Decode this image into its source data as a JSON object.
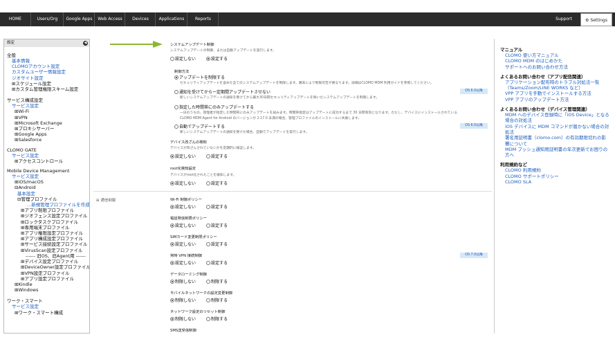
{
  "nav": {
    "tabs": [
      "HOME",
      "Users/Org",
      "Google Apps",
      "Web Access",
      "Devices",
      "Applications",
      "Reports"
    ],
    "support": "Support",
    "settings": "Settings"
  },
  "left": {
    "header": "設定",
    "groups": [
      {
        "title": "全般",
        "items": [
          {
            "t": "基本情報",
            "c": "link",
            "l": 1
          },
          {
            "t": "CLOMOアカウント設定",
            "c": "link",
            "l": 1
          },
          {
            "t": "カスタムユーザー情報設定",
            "c": "link",
            "l": 1
          },
          {
            "t": "ジオサイト設定",
            "c": "link",
            "l": 1
          },
          {
            "t": "⊞スケジュール設定",
            "c": "text",
            "l": 1
          },
          {
            "t": "⊞カスタム管理権限スキーム設定",
            "c": "text",
            "l": 1
          }
        ]
      },
      {
        "title": "サービス構成設定",
        "items": [
          {
            "t": "サービス設定",
            "c": "link",
            "l": 1
          },
          {
            "t": "⊞Wi-Fi",
            "c": "text",
            "l": 2
          },
          {
            "t": "⊞VPN",
            "c": "text",
            "l": 2
          },
          {
            "t": "⊞Microsoft Exchange",
            "c": "text",
            "l": 2
          },
          {
            "t": "⊞プロキシサーバー",
            "c": "text",
            "l": 2
          },
          {
            "t": "⊞Google Apps",
            "c": "text",
            "l": 2
          },
          {
            "t": "⊞Salesforce",
            "c": "text",
            "l": 2
          }
        ]
      },
      {
        "title": "CLOMO GATE",
        "items": [
          {
            "t": "サービス設定",
            "c": "link",
            "l": 1
          },
          {
            "t": "⊞アクセスコントロール",
            "c": "text",
            "l": 2
          }
        ]
      },
      {
        "title": "Mobile Device Management",
        "items": [
          {
            "t": "サービス設定",
            "c": "link",
            "l": 1
          },
          {
            "t": "⊞iOS/macOS",
            "c": "text",
            "l": 2
          },
          {
            "t": "⊟Android",
            "c": "text",
            "l": 2
          },
          {
            "t": "基本設定",
            "c": "link",
            "l": 3
          },
          {
            "t": "⊟管理プロファイル",
            "c": "text",
            "l": 3
          },
          {
            "t": "...新規管理プロファイルを作成",
            "c": "link",
            "l": 6
          },
          {
            "t": "⊞アプリ制限プロファイル",
            "c": "text",
            "l": 4
          },
          {
            "t": "⊞ジオフェンス設定プロファイル",
            "c": "text",
            "l": 4
          },
          {
            "t": "⊞ロックタスクプロファイル",
            "c": "text",
            "l": 4
          },
          {
            "t": "⊞専用端末プロファイル",
            "c": "text",
            "l": 4
          },
          {
            "t": "⊞アプリ権限設定プロファイル",
            "c": "text",
            "l": 4
          },
          {
            "t": "⊞アプリ構成設定プロファイル",
            "c": "text",
            "l": 4
          },
          {
            "t": "⊞サービス接続設定プロファイル",
            "c": "text",
            "l": 4
          },
          {
            "t": "⊞VirusScan設定プロファイル",
            "c": "text",
            "l": 4
          },
          {
            "t": "------ 旧OS、旧Agent用 ------",
            "c": "text",
            "l": 5
          },
          {
            "t": "⊞デバイス設定プロファイル",
            "c": "text",
            "l": 4
          },
          {
            "t": "⊞DeviceOwner設定プロファイル",
            "c": "text",
            "l": 4
          },
          {
            "t": "⊞VPN設定プロファイル",
            "c": "text",
            "l": 4
          },
          {
            "t": "⊞アプリ設定プロファイル",
            "c": "text",
            "l": 4
          },
          {
            "t": "⊞Kindle",
            "c": "text",
            "l": 2
          },
          {
            "t": "⊞Windows",
            "c": "text",
            "l": 2
          }
        ]
      },
      {
        "title": "ワーク・スマート",
        "items": [
          {
            "t": "サービス設定",
            "c": "link",
            "l": 1
          },
          {
            "t": "⊞ワーク・スマート構成",
            "c": "text",
            "l": 2
          }
        ]
      }
    ]
  },
  "main": {
    "sysupdate": {
      "title": "システムアップデート制御",
      "desc": "システムアップデートの制御、または自動アップデートを実行します。",
      "off": "設定しない",
      "on": "設定する"
    },
    "method": {
      "title": "制御方法",
      "opts": [
        {
          "label": "アップデートを制限する",
          "desc": [
            "セキュリティアップデートを含めた全てのシステムアップデートを制限します。端末により制限可否が異なります。詳細はCLOMO MDM 利用ガイドを参照してください。"
          ]
        },
        {
          "label": "通知を受けてから一定期間アップデートさせない",
          "badge": "OS 6.0以降",
          "desc": [
            "新しいシステムアップデートの通知を受けてから最大30日間セキュリティアップデートを除いたシステムアップデートを制限します。"
          ]
        },
        {
          "label": "指定した時間帯にのみアップデートする",
          "desc": [
            "一日のうちの、管理者が指定した時間帯にのみアップデートを試みます。時間帯指定はアップデートに成功するまで 30 日間有効となります。ただし、デバイスにインストールされている",
            "CLOMO MDM Agent for Android のバージョンが 2.17.0 未満の場合、管理プロファイルのインストールに失敗します。"
          ]
        },
        {
          "label": "自動でアップデートする",
          "badge": "OS 6.0以降",
          "desc": [
            "新しいシステムアップデートの通知を受けた場合、自動でアップデートを実行します。"
          ]
        }
      ]
    },
    "tamper": {
      "title": "デバイス改ざんの検知",
      "desc": "デバイスが改ざんされていないかを定期的に検証します。",
      "off": "設定しない",
      "on": "設定する"
    },
    "root": {
      "title": "root化検知設定",
      "desc": "デバイスがroot化されたことを検知します。",
      "off": "設定しない",
      "on": "設定する"
    },
    "section": "通信制御",
    "policies": [
      {
        "title": "Wi-Fi 制御ポリシー",
        "a": "設定しない",
        "b": "設定する"
      },
      {
        "title": "電話発信制限ポリシー",
        "a": "設定しない",
        "b": "設定する"
      },
      {
        "title": "SIMカード変更制限ポリシー",
        "a": "設定しない",
        "b": "設定する"
      },
      {
        "title": "常時 VPN 接続制御",
        "a": "設定しない",
        "b": "設定する",
        "badge": "OS 7.0以降"
      },
      {
        "title": "データローミング制御",
        "a": "制限しない",
        "b": "制限する"
      },
      {
        "title": "モバイルネットワークの設定変更制御",
        "a": "制限しない",
        "b": "制限する"
      },
      {
        "title": "ネットワーク設定のリセット制御",
        "a": "制限しない",
        "b": "制限する"
      },
      {
        "title": "SMS送受信制御",
        "a": "",
        "b": ""
      }
    ]
  },
  "right": {
    "groups": [
      {
        "h": "マニュアル",
        "items": [
          "CLOMO 使い方マニュアル",
          "CLOMO MDM のはじめかた",
          "サポートへのお問い合わせ方法"
        ]
      },
      {
        "h": "よくあるお問い合わせ（アプリ配信関連）",
        "items": [
          "アプリケーション配布時のトラブル対処法一覧",
          "（Teams/Zoom/LINE WORKS など）",
          "VPP アプリを手動でインストールする方法",
          "VPP アプリのアップデート方法"
        ]
      },
      {
        "h": "よくあるお問い合わせ（デバイス管理関連）",
        "items": [
          "MDM へのデバイス登録時に「iOS Device」となる",
          "場合の対処法",
          "iOS デバイスに MDM コマンドが届かない場合の対",
          "処法",
          "署名用証明書（clomo.com）の有効期限切れの影",
          "響について",
          "MDM プッシュ通知用証明書の年次更新でお困りの",
          "方へ"
        ]
      },
      {
        "h": "利用規約など",
        "items": [
          "CLOMO 利用規約",
          "CLOMO サポートポリシー",
          "CLOMO SLA"
        ]
      }
    ]
  }
}
